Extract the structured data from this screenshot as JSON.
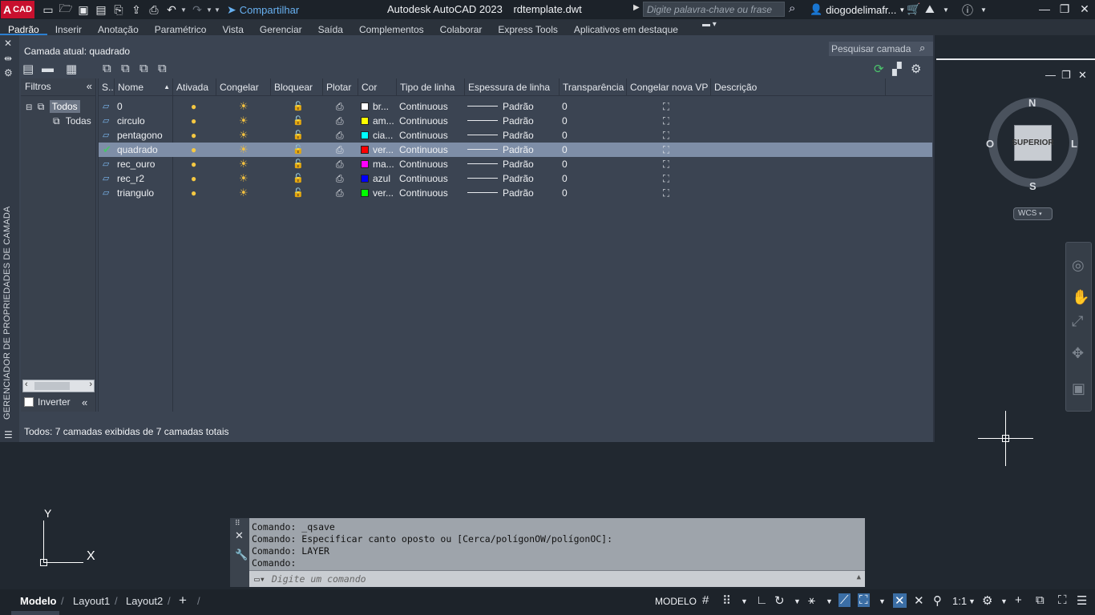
{
  "titlebar": {
    "app_logo_letter": "A",
    "app_logo_text": "CAD",
    "share_label": "Compartilhar",
    "app_name": "Autodesk AutoCAD 2023",
    "file_name": "rdtemplate.dwt",
    "search_placeholder": "Digite palavra-chave ou frase",
    "user_name": "diogodelimafr...",
    "qat_icons": [
      "new-icon",
      "open-icon",
      "save-icon",
      "save-as-icon",
      "open-web-icon",
      "save-web-icon",
      "print-icon",
      "undo-icon",
      "redo-icon"
    ]
  },
  "ribbon": {
    "tabs": [
      "Padrão",
      "Inserir",
      "Anotação",
      "Paramétrico",
      "Vista",
      "Gerenciar",
      "Saída",
      "Complementos",
      "Colaborar",
      "Express Tools",
      "Aplicativos em destaque"
    ],
    "active_tab": "Padrão"
  },
  "palette": {
    "side_label": "GERENCIADOR DE PROPRIEDADES DE CAMADA",
    "current_layer_label": "Camada atual: quadrado",
    "search_layer": "Pesquisar camada",
    "filters_title": "Filtros",
    "tree_all": "Todos",
    "tree_used": "Todas",
    "invert_label": "Inverter",
    "status_text": "Todos: 7 camadas exibidas de 7 camadas totais",
    "columns": [
      "S..",
      "Nome",
      "Ativada",
      "Congelar",
      "Bloquear",
      "Plotar",
      "Cor",
      "Tipo de linha",
      "Espessura de linha",
      "Transparência",
      "Congelar nova VP",
      "Descrição"
    ],
    "layers": [
      {
        "name": "0",
        "color_name": "br...",
        "color": "#ffffff",
        "linetype": "Continuous",
        "lineweight": "Padrão",
        "transparency": "0",
        "current": false
      },
      {
        "name": "circulo",
        "color_name": "am...",
        "color": "#ffff00",
        "linetype": "Continuous",
        "lineweight": "Padrão",
        "transparency": "0",
        "current": false
      },
      {
        "name": "pentagono",
        "color_name": "cia...",
        "color": "#00ffff",
        "linetype": "Continuous",
        "lineweight": "Padrão",
        "transparency": "0",
        "current": false
      },
      {
        "name": "quadrado",
        "color_name": "ver...",
        "color": "#ff0000",
        "linetype": "Continuous",
        "lineweight": "Padrão",
        "transparency": "0",
        "current": true
      },
      {
        "name": "rec_ouro",
        "color_name": "ma...",
        "color": "#ff00ff",
        "linetype": "Continuous",
        "lineweight": "Padrão",
        "transparency": "0",
        "current": false
      },
      {
        "name": "rec_r2",
        "color_name": "azul",
        "color": "#0000ff",
        "linetype": "Continuous",
        "lineweight": "Padrão",
        "transparency": "0",
        "current": false
      },
      {
        "name": "triangulo",
        "color_name": "ver...",
        "color": "#00ff00",
        "linetype": "Continuous",
        "lineweight": "Padrão",
        "transparency": "0",
        "current": false
      }
    ]
  },
  "viewcube": {
    "north": "N",
    "south": "S",
    "east": "L",
    "west": "O",
    "face": "SUPERIOR",
    "wcs": "WCS"
  },
  "ucs": {
    "x": "X",
    "y": "Y"
  },
  "command": {
    "history": [
      "Comando: _qsave",
      "Comando: Especificar canto oposto ou [Cerca/polígonOW/polígonOC]:",
      "Comando: LAYER",
      "Comando:"
    ],
    "placeholder": "Digite um comando"
  },
  "statusbar": {
    "tabs": [
      "Modelo",
      "Layout1",
      "Layout2"
    ],
    "add_tab": "+",
    "model_label": "MODELO",
    "scale": "1:1"
  }
}
